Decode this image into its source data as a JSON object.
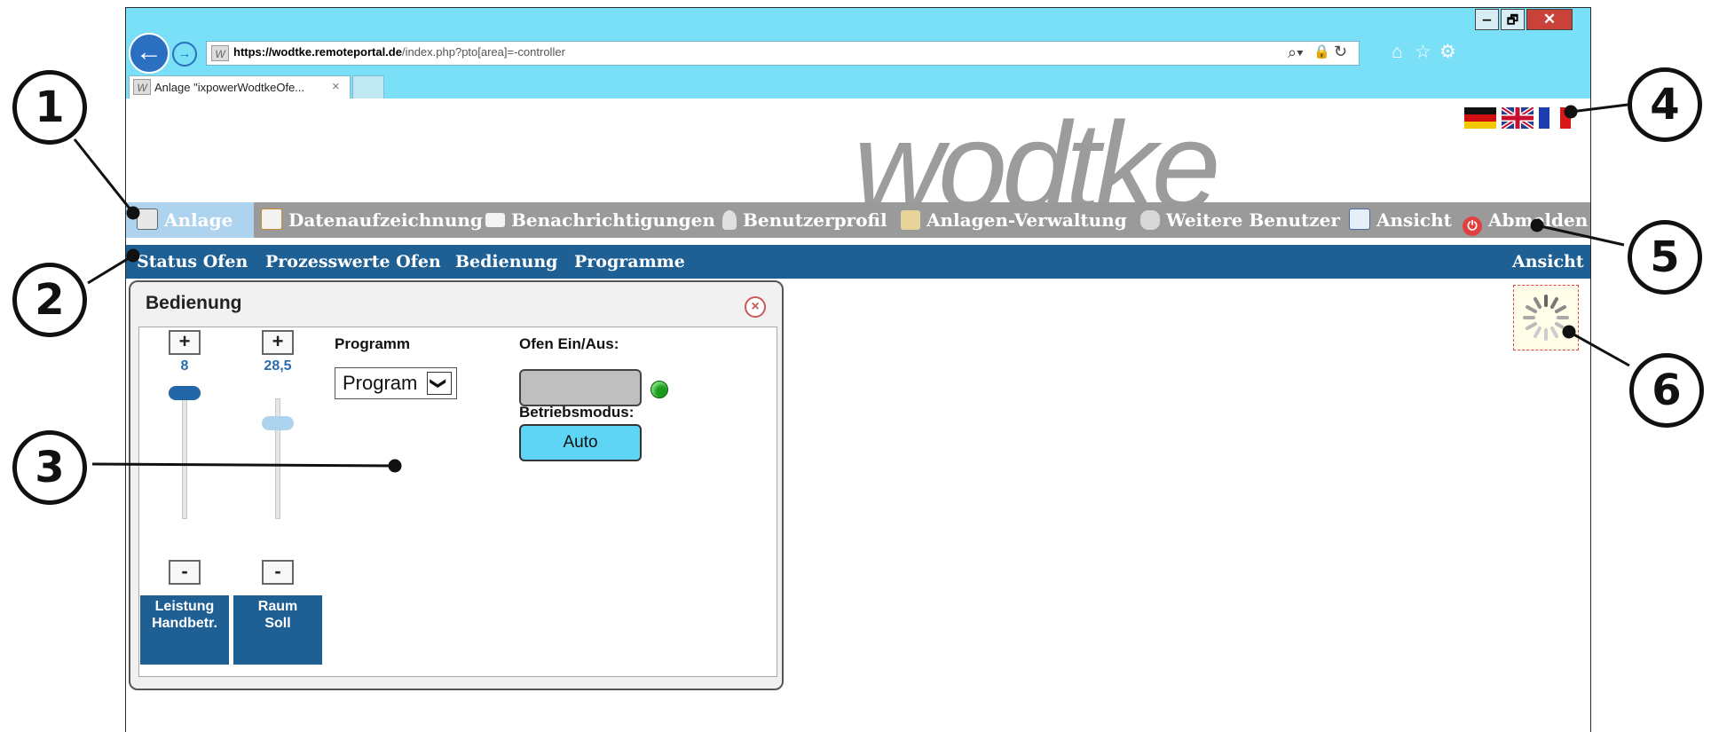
{
  "browser": {
    "url_prefix": "https://wodtke.",
    "url_host": "remoteportal.de",
    "url_rest": "/index.php?pto[area]=-controller",
    "tab_title": "Anlage \"ixpowerWodtkeOfe...",
    "tab_close": "×",
    "window_buttons": [
      "‒",
      "🗗",
      "✕"
    ],
    "toolbar_icons": [
      "search-icon",
      "lock-icon",
      "refresh-icon",
      "home-icon",
      "favorites-star-icon",
      "settings-gear-icon"
    ],
    "wicon_letter": "W"
  },
  "logo": "wodtke",
  "languages": [
    "Deutsch",
    "English",
    "Français"
  ],
  "main_nav": [
    {
      "label": "Anlage",
      "icon": "plant-icon",
      "active": true
    },
    {
      "label": "Datenaufzeichnung",
      "icon": "chart-icon"
    },
    {
      "label": "Benachrichtigungen",
      "icon": "envelope-icon"
    },
    {
      "label": "Benutzerprofil",
      "icon": "user-icon"
    },
    {
      "label": "Anlagen-Verwaltung",
      "icon": "tools-icon"
    },
    {
      "label": "Weitere Benutzer",
      "icon": "users-icon"
    },
    {
      "label": "Ansicht",
      "icon": "monitor-icon"
    },
    {
      "label": "Abmelden",
      "icon": "power-icon"
    }
  ],
  "sub_nav": [
    "Status Ofen",
    "Prozesswerte Ofen",
    "Bedienung",
    "Programme"
  ],
  "sub_nav_right": "Ansicht",
  "panel": {
    "title": "Bedienung",
    "close_icon": "×",
    "plus": "+",
    "minus": "-",
    "sliders": [
      {
        "value": "8",
        "label_line1": "Leistung",
        "label_line2": "Handbetr.",
        "level": 1.0
      },
      {
        "value": "28,5",
        "label_line1": "Raum",
        "label_line2": "Soll",
        "level": 0.77
      }
    ],
    "programm_label": "Programm",
    "programm_value": "Program",
    "dropdown_arrow": "❯",
    "ofen_label": "Ofen Ein/Aus:",
    "betriebsmodus_label": "Betriebsmodus:",
    "betriebsmodus_value": "Auto"
  },
  "callouts": [
    "1",
    "2",
    "3",
    "4",
    "5",
    "6"
  ],
  "colors": {
    "titlebar": "#79e0f7",
    "nav_bg": "#9a9a9a",
    "nav_active": "#aed3ef",
    "subnav_bg": "#1e5f94",
    "mode_button": "#5fd5f5",
    "led": "#1a9a1a"
  }
}
